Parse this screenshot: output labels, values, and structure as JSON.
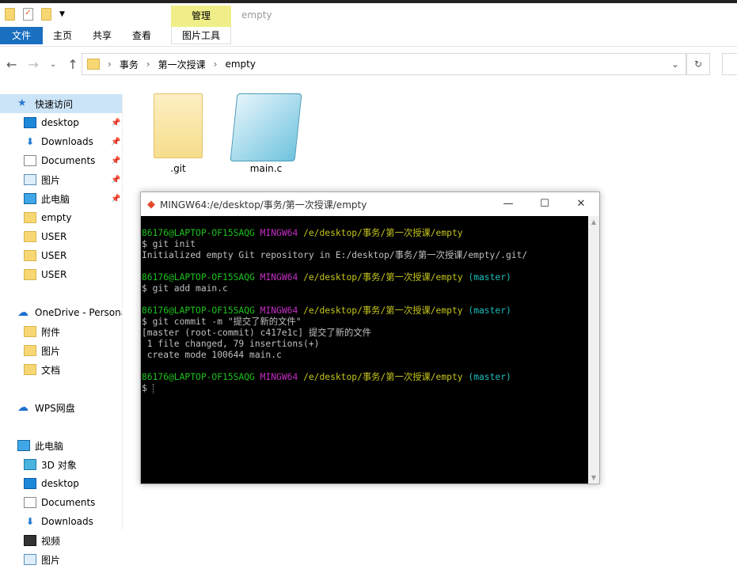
{
  "ribbon": {
    "manage": "管理",
    "window_title": "empty",
    "tabs": [
      "文件",
      "主页",
      "共享",
      "查看"
    ],
    "picture_tools": "图片工具"
  },
  "address": {
    "crumbs": [
      "事务",
      "第一次授课",
      "empty"
    ]
  },
  "sidebar": {
    "items": [
      {
        "label": "快速访问",
        "icon": "star-icon",
        "hdr": true,
        "sel": true
      },
      {
        "label": "desktop",
        "icon": "desktop-icon",
        "pin": true
      },
      {
        "label": "Downloads",
        "icon": "download-icon",
        "pin": true
      },
      {
        "label": "Documents",
        "icon": "documents-icon",
        "pin": true
      },
      {
        "label": "图片",
        "icon": "pictures-icon",
        "pin": true
      },
      {
        "label": "此电脑",
        "icon": "computer-icon",
        "pin": true
      },
      {
        "label": "empty",
        "icon": "folder-icon"
      },
      {
        "label": "USER",
        "icon": "folder-icon"
      },
      {
        "label": "USER",
        "icon": "folder-icon"
      },
      {
        "label": "USER",
        "icon": "folder-icon"
      },
      {
        "label": "",
        "icon": ""
      },
      {
        "label": "OneDrive - Persona",
        "icon": "cloud-icon",
        "hdr": true
      },
      {
        "label": "附件",
        "icon": "folder-icon"
      },
      {
        "label": "图片",
        "icon": "folder-icon"
      },
      {
        "label": "文档",
        "icon": "folder-icon"
      },
      {
        "label": "",
        "icon": ""
      },
      {
        "label": "WPS网盘",
        "icon": "cloud-icon",
        "hdr": true
      },
      {
        "label": "",
        "icon": ""
      },
      {
        "label": "此电脑",
        "icon": "computer-icon",
        "hdr": true
      },
      {
        "label": "3D 对象",
        "icon": "3d-objects-icon"
      },
      {
        "label": "desktop",
        "icon": "desktop-icon"
      },
      {
        "label": "Documents",
        "icon": "documents-icon"
      },
      {
        "label": "Downloads",
        "icon": "download-icon"
      },
      {
        "label": "视频",
        "icon": "video-icon"
      },
      {
        "label": "图片",
        "icon": "pictures-icon"
      }
    ]
  },
  "files": [
    {
      "name": ".git",
      "type": "folder"
    },
    {
      "name": "main.c",
      "type": "notepad"
    }
  ],
  "terminal": {
    "title": "MINGW64:/e/desktop/事务/第一次授课/empty",
    "prompt": {
      "user": "86176@LAPTOP-OF15SAQG",
      "env": "MINGW64",
      "path": "/e/desktop/事务/第一次授课/empty",
      "branch": "(master)"
    },
    "lines": [
      {
        "p": true,
        "branch": false
      },
      {
        "t": "$ git init"
      },
      {
        "t": "Initialized empty Git repository in E:/desktop/事务/第一次授课/empty/.git/"
      },
      {
        "t": ""
      },
      {
        "p": true,
        "branch": true
      },
      {
        "t": "$ git add main.c"
      },
      {
        "t": ""
      },
      {
        "p": true,
        "branch": true
      },
      {
        "t": "$ git commit -m \"提交了新的文件\""
      },
      {
        "t": "[master (root-commit) c417e1c] 提交了新的文件"
      },
      {
        "t": " 1 file changed, 79 insertions(+)"
      },
      {
        "t": " create mode 100644 main.c"
      },
      {
        "t": ""
      },
      {
        "p": true,
        "branch": true
      },
      {
        "t": "$ "
      }
    ]
  }
}
